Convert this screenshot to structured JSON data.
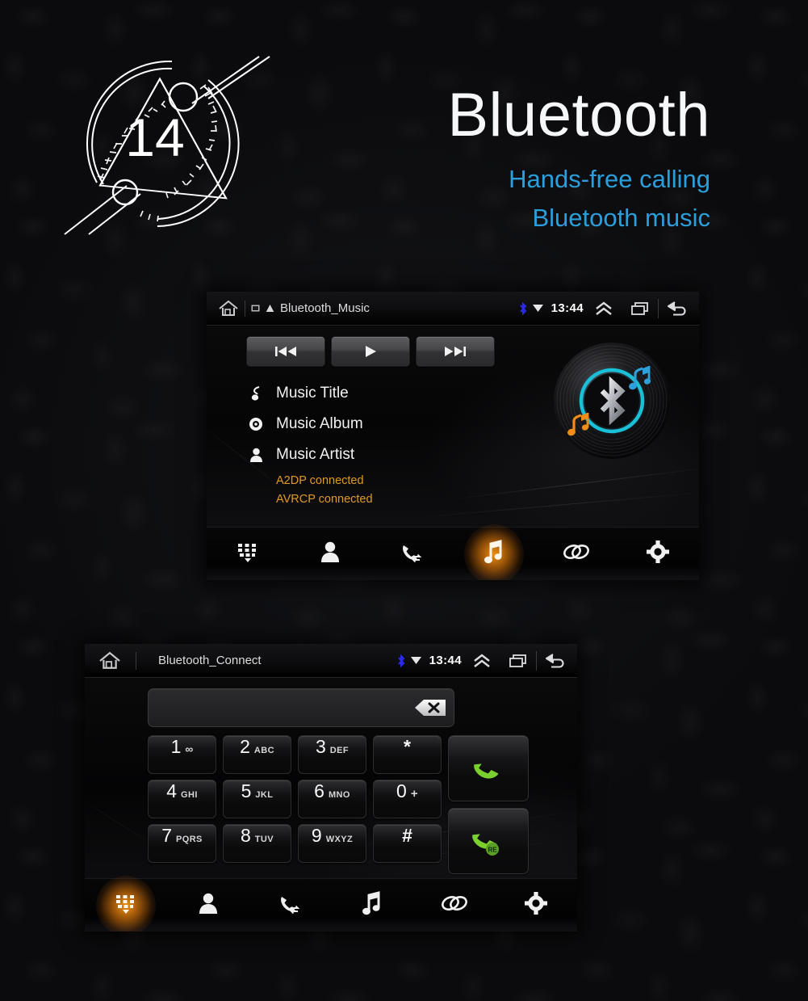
{
  "page": {
    "badge_number": "14",
    "title": "Bluetooth",
    "subtitle_line1": "Hands-free calling",
    "subtitle_line2": "Bluetooth music",
    "accent_blue": "#2a9fdb",
    "accent_orange": "#e09a22",
    "accent_cyan": "#19c0d8",
    "accent_green": "#76c832"
  },
  "music_screen": {
    "statusbar": {
      "home_icon": "home-icon",
      "sd_icon": "sdcard-icon",
      "warning_icon": "warning-icon",
      "title": "Bluetooth_Music",
      "bluetooth_icon": "bluetooth-icon",
      "dropdown_icon": "caret-down-icon",
      "time": "13:44",
      "expand_icon": "double-chevron-up-icon",
      "recents_icon": "recents-icon",
      "back_icon": "back-icon"
    },
    "controls": {
      "previous_label": "prev-track-icon",
      "play_label": "play-icon",
      "next_label": "next-track-icon"
    },
    "track": {
      "title_icon": "music-note-icon",
      "title": "Music Title",
      "album_icon": "disc-icon",
      "album": "Music Album",
      "artist_icon": "person-icon",
      "artist": "Music Artist",
      "a2dp_status": "A2DP connected",
      "avrcp_status": "AVRCP connected"
    },
    "artwork": {
      "name": "vinyl-bluetooth-artwork",
      "ring_color": "#19c0d8",
      "note_blue": "#2f9fd8",
      "note_orange": "#f08c18"
    },
    "nav": [
      {
        "name": "nav-keypad",
        "icon": "dialpad-icon",
        "active": false
      },
      {
        "name": "nav-contacts",
        "icon": "contacts-icon",
        "active": false
      },
      {
        "name": "nav-call-log",
        "icon": "call-log-icon",
        "active": false
      },
      {
        "name": "nav-music",
        "icon": "music-note-icon",
        "active": true
      },
      {
        "name": "nav-pair",
        "icon": "link-icon",
        "active": false
      },
      {
        "name": "nav-settings",
        "icon": "gear-icon",
        "active": false
      }
    ]
  },
  "dialer_screen": {
    "statusbar": {
      "home_icon": "home-icon",
      "title": "Bluetooth_Connect",
      "bluetooth_icon": "bluetooth-icon",
      "dropdown_icon": "caret-down-icon",
      "time": "13:44",
      "expand_icon": "double-chevron-up-icon",
      "recents_icon": "recents-icon",
      "back_icon": "back-icon"
    },
    "number_input": {
      "value": "",
      "placeholder": "",
      "backspace_icon": "backspace-icon"
    },
    "keys": [
      [
        {
          "num": "1",
          "sub": "∞",
          "name": "key-1"
        },
        {
          "num": "2",
          "sub": "ABC",
          "name": "key-2"
        },
        {
          "num": "3",
          "sub": "DEF",
          "name": "key-3"
        },
        {
          "num": "*",
          "sub": "",
          "name": "key-star"
        }
      ],
      [
        {
          "num": "4",
          "sub": "GHI",
          "name": "key-4"
        },
        {
          "num": "5",
          "sub": "JKL",
          "name": "key-5"
        },
        {
          "num": "6",
          "sub": "MNO",
          "name": "key-6"
        },
        {
          "num": "0",
          "sub": "+",
          "name": "key-0"
        }
      ],
      [
        {
          "num": "7",
          "sub": "PQRS",
          "name": "key-7"
        },
        {
          "num": "8",
          "sub": "TUV",
          "name": "key-8"
        },
        {
          "num": "9",
          "sub": "WXYZ",
          "name": "key-9"
        },
        {
          "num": "#",
          "sub": "",
          "name": "key-hash"
        }
      ]
    ],
    "call_buttons": [
      {
        "name": "call-button",
        "icon": "phone-handset-icon",
        "badge": ""
      },
      {
        "name": "redial-button",
        "icon": "phone-handset-icon",
        "badge": "RE"
      }
    ],
    "nav": [
      {
        "name": "nav-keypad",
        "icon": "dialpad-icon",
        "active": true
      },
      {
        "name": "nav-contacts",
        "icon": "contacts-icon",
        "active": false
      },
      {
        "name": "nav-call-log",
        "icon": "call-log-icon",
        "active": false
      },
      {
        "name": "nav-music",
        "icon": "music-note-icon",
        "active": false
      },
      {
        "name": "nav-pair",
        "icon": "link-icon",
        "active": false
      },
      {
        "name": "nav-settings",
        "icon": "gear-icon",
        "active": false
      }
    ]
  }
}
